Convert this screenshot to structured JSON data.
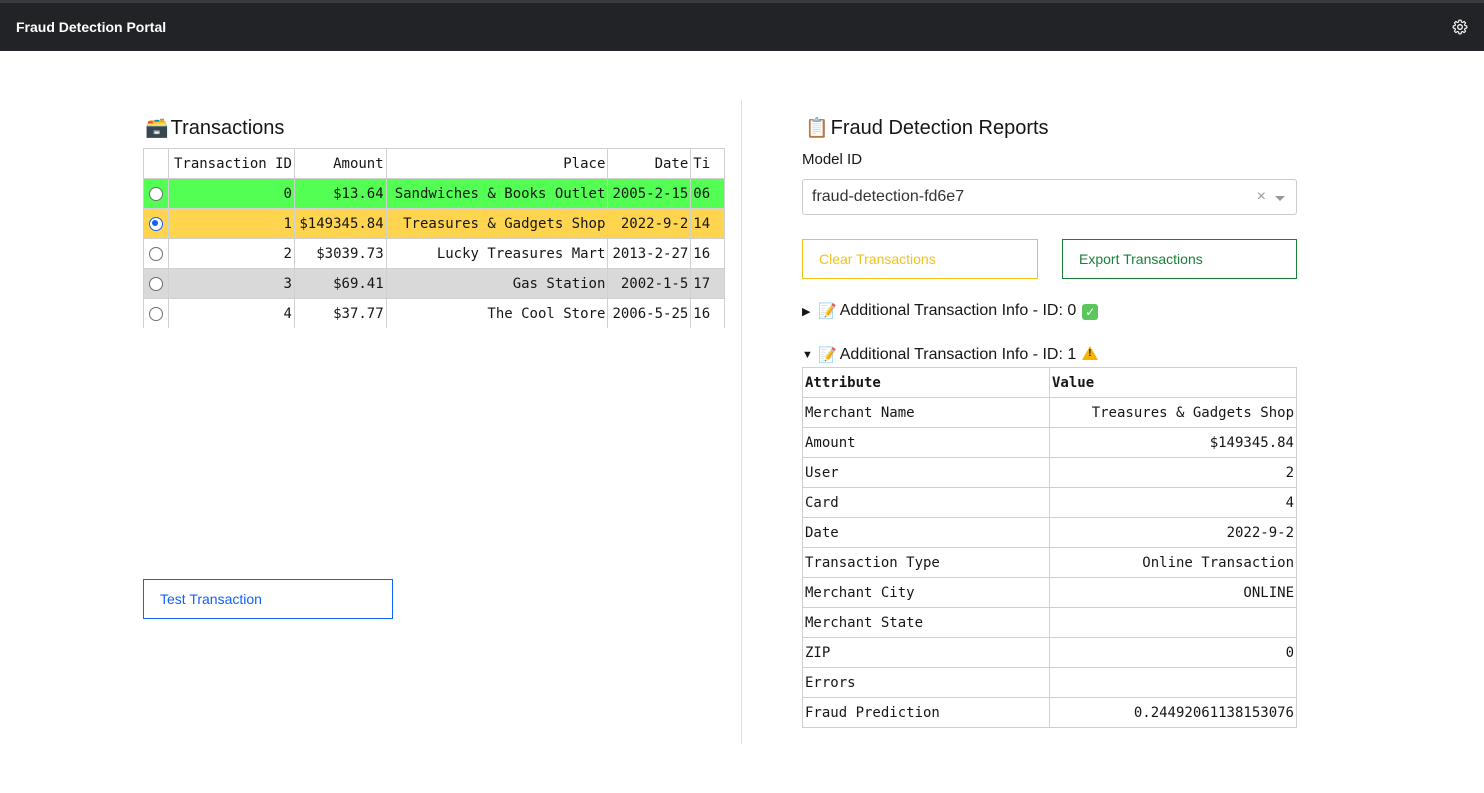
{
  "header": {
    "title": "Fraud Detection Portal",
    "settings_icon": "gear-icon"
  },
  "transactions": {
    "title": "Transactions",
    "title_emoji": "🗃️",
    "columns": [
      "",
      "Transaction ID",
      "Amount",
      "Place",
      "Date",
      "Ti"
    ],
    "rows": [
      {
        "selected": false,
        "id": "0",
        "amount": "$13.64",
        "place": "Sandwiches & Books Outlet",
        "date": "2005-2-15",
        "time": "06"
      },
      {
        "selected": true,
        "id": "1",
        "amount": "$149345.84",
        "place": "Treasures & Gadgets Shop",
        "date": "2022-9-2",
        "time": "14"
      },
      {
        "selected": false,
        "id": "2",
        "amount": "$3039.73",
        "place": "Lucky Treasures Mart",
        "date": "2013-2-27",
        "time": "16"
      },
      {
        "selected": false,
        "id": "3",
        "amount": "$69.41",
        "place": "Gas Station",
        "date": "2002-1-5",
        "time": "17"
      },
      {
        "selected": false,
        "id": "4",
        "amount": "$37.77",
        "place": "The Cool Store",
        "date": "2006-5-25",
        "time": "16"
      }
    ],
    "row_colors": [
      "#52ff52",
      "#ffd54f",
      "#ffffff",
      "#d9d9d9",
      "#ffffff"
    ],
    "test_button": "Test Transaction"
  },
  "reports": {
    "title": "Fraud Detection Reports",
    "title_emoji": "📋",
    "model_label": "Model ID",
    "model_value": "fraud-detection-fd6e7",
    "clear_button": "Clear Transactions",
    "export_button": "Export Transactions",
    "details": [
      {
        "label": "Additional Transaction Info - ID: 0",
        "expanded": false,
        "status_icon": "check-icon"
      },
      {
        "label": "Additional Transaction Info - ID: 1",
        "expanded": true,
        "status_icon": "warning-icon"
      }
    ],
    "info_table": {
      "headers": [
        "Attribute",
        "Value"
      ],
      "rows": [
        [
          "Merchant Name",
          "Treasures & Gadgets Shop"
        ],
        [
          "Amount",
          "$149345.84"
        ],
        [
          "User",
          "2"
        ],
        [
          "Card",
          "4"
        ],
        [
          "Date",
          "2022-9-2"
        ],
        [
          "Transaction Type",
          "Online Transaction"
        ],
        [
          "Merchant City",
          "ONLINE"
        ],
        [
          "Merchant State",
          ""
        ],
        [
          "ZIP",
          "0"
        ],
        [
          "Errors",
          ""
        ],
        [
          "Fraud Prediction",
          "0.24492061138153076"
        ]
      ]
    }
  },
  "colors": {
    "topbar": "#222326",
    "primary": "#0f62fe",
    "warning": "#f1c21b",
    "success": "#198038"
  }
}
